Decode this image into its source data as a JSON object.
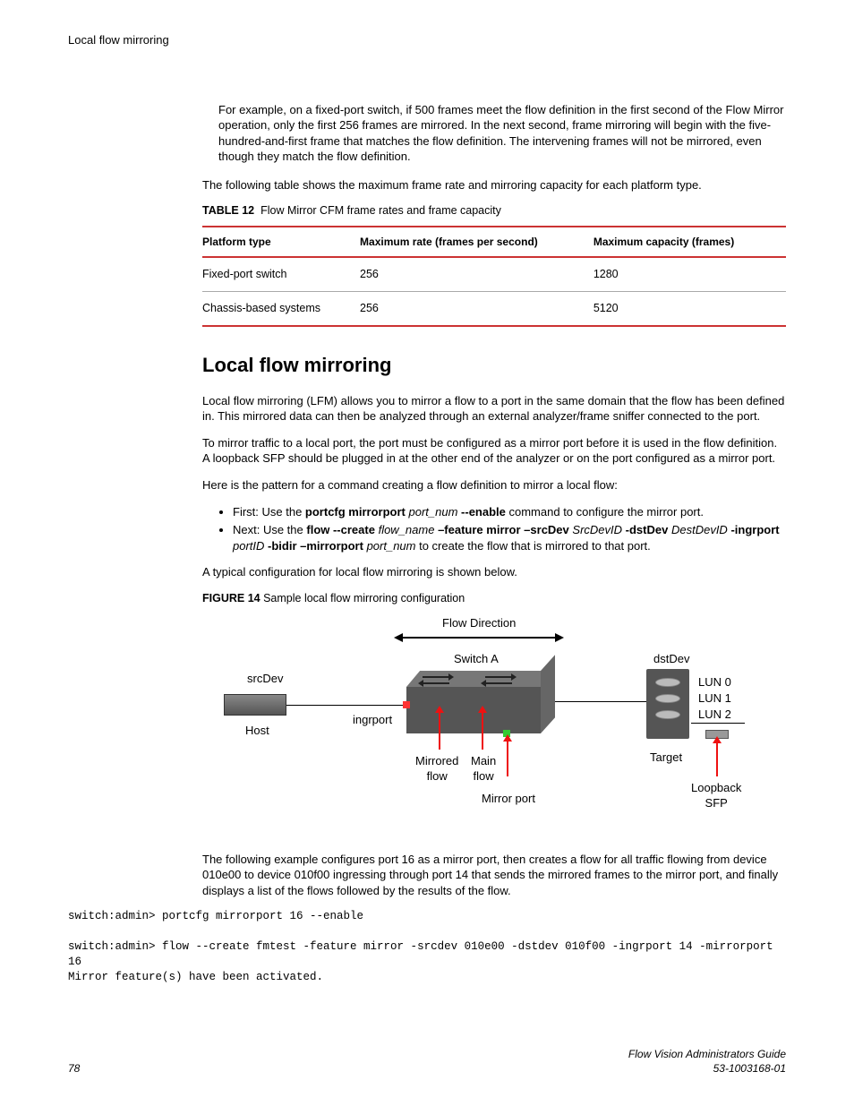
{
  "header": {
    "running_title": "Local flow mirroring"
  },
  "intro": {
    "example_para": "For example, on a fixed-port switch, if 500 frames meet the flow definition in the first second of the Flow Mirror operation, only the first 256 frames are mirrored. In the next second, frame mirroring will begin with the five-hundred-and-first frame that matches the flow definition. The intervening frames will not be mirrored, even though they match the flow definition.",
    "table_lead": "The following table shows the maximum frame rate and mirroring capacity for each platform type."
  },
  "table12": {
    "label": "TABLE 12",
    "caption": "Flow Mirror CFM frame rates and frame capacity",
    "headers": [
      "Platform type",
      "Maximum rate (frames per second)",
      "Maximum capacity (frames)"
    ],
    "rows": [
      [
        "Fixed-port switch",
        "256",
        "1280"
      ],
      [
        "Chassis-based systems",
        "256",
        "5120"
      ]
    ]
  },
  "section": {
    "heading": "Local flow mirroring",
    "p1": "Local flow mirroring (LFM) allows you to mirror a flow to a port in the same domain that the flow has been defined in. This mirrored data can then be analyzed through an external analyzer/frame sniffer connected to the port.",
    "p2": "To mirror traffic to a local port, the port must be configured as a mirror port before it is used in the flow definition. A loopback SFP should be plugged in at the other end of the analyzer or on the port configured as a mirror port.",
    "p3": "Here is the pattern for a command creating a flow definition to mirror a local flow:",
    "bullets": {
      "b1": {
        "lead": "First: Use the ",
        "cmd1": "portcfg mirrorport",
        "arg1": "port_num",
        "cmd2": "--enable",
        "tail": " command to configure the mirror port."
      },
      "b2": {
        "lead": "Next: Use the ",
        "cmd1": "flow --create",
        "arg1": "flow_name",
        "cmd2": "–feature mirror –srcDev",
        "arg2": "SrcDevID",
        "cmd3": "-dstDev",
        "arg3": "DestDevID",
        "cmd4": "-ingrport",
        "arg4": "portID",
        "cmd5": "-bidir –mirrorport",
        "arg5": "port_num",
        "tail": " to create the flow that is mirrored to that port."
      }
    },
    "p4": "A typical configuration for local flow mirroring is shown below."
  },
  "figure14": {
    "label": "FIGURE 14",
    "caption": "Sample local flow mirroring configuration",
    "labels": {
      "flow_direction": "Flow Direction",
      "switch_a": "Switch A",
      "dstdev": "dstDev",
      "srcdev": "srcDev",
      "host": "Host",
      "ingrport": "ingrport",
      "mirrored_flow": "Mirrored\nflow",
      "main_flow": "Main\nflow",
      "mirror_port": "Mirror port",
      "target": "Target",
      "loopback_sfp": "Loopback\nSFP",
      "lun0": "LUN 0",
      "lun1": "LUN 1",
      "lun2": "LUN 2"
    }
  },
  "example_para": "The following example configures port 16 as a mirror port, then creates a flow for all traffic flowing from device 010e00 to device 010f00 ingressing through port 14 that sends the mirrored frames to the mirror port, and finally displays a list of the flows followed by the results of the flow.",
  "cli": "switch:admin> portcfg mirrorport 16 --enable\n\nswitch:admin> flow --create fmtest -feature mirror -srcdev 010e00 -dstdev 010f00 -ingrport 14 -mirrorport 16\nMirror feature(s) have been activated.",
  "footer": {
    "page": "78",
    "guide_title": "Flow Vision Administrators Guide",
    "doc_number": "53-1003168-01"
  }
}
